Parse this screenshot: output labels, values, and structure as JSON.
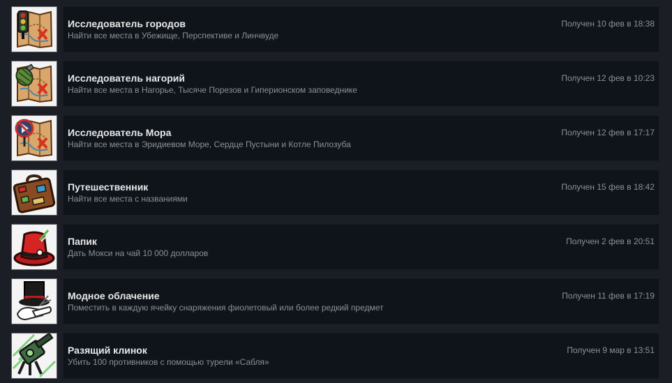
{
  "achievements": [
    {
      "title": "Исследователь городов",
      "description": "Найти все места в Убежище, Перспективе и Линчвуде",
      "unlocked": "Получен 10 фев в 18:38",
      "icon": "map-traffic-light-icon"
    },
    {
      "title": "Исследователь нагорий",
      "description": "Найти все места в Нагорье, Тысяче Порезов и Гиперионском заповеднике",
      "unlocked": "Получен 12 фев в 10:23",
      "icon": "map-grenade-icon"
    },
    {
      "title": "Исследователь Мора",
      "description": "Найти все места в Эридиевом Море, Сердце Пустыни и Котле Пилозуба",
      "unlocked": "Получен 12 фев в 17:17",
      "icon": "map-no-entry-sign-icon"
    },
    {
      "title": "Путешественник",
      "description": "Найти все места с названиями",
      "unlocked": "Получен 15 фев в 18:42",
      "icon": "suitcase-icon"
    },
    {
      "title": "Папик",
      "description": "Дать Мокси на чай 10 000 долларов",
      "unlocked": "Получен 2 фев в 20:51",
      "icon": "red-top-hat-icon"
    },
    {
      "title": "Модное облачение",
      "description": "Поместить в каждую ячейку снаряжения фиолетовый или более редкий предмет",
      "unlocked": "Получен 11 фев в 17:19",
      "icon": "top-hat-gloves-icon"
    },
    {
      "title": "Разящий клинок",
      "description": "Убить 100 противников с помощью турели «Сабля»",
      "unlocked": "Получен 9 мар в 13:51",
      "icon": "turret-icon"
    }
  ],
  "colors": {
    "page_background": "#1b1e24",
    "panel_background": "#0f141b",
    "title_text": "#e8e8e8",
    "secondary_text": "#8c9096",
    "icon_frame_border": "#5a5e66"
  }
}
